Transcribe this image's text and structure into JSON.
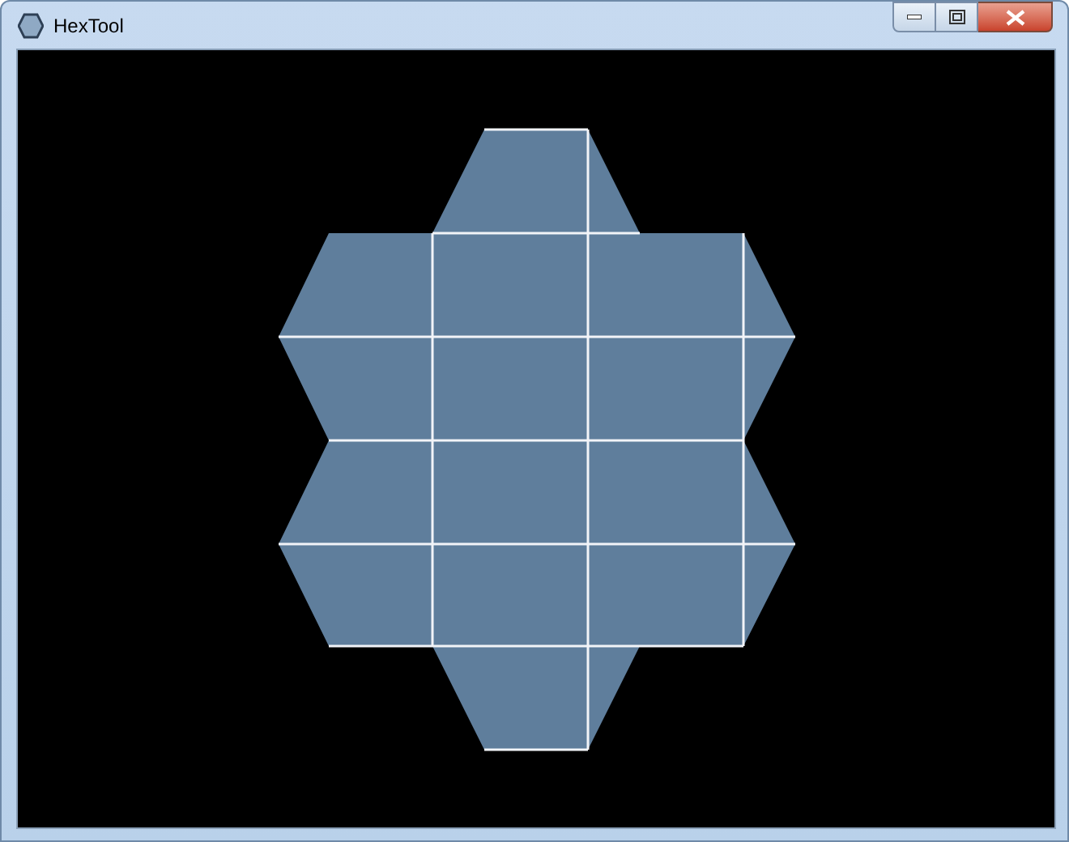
{
  "window": {
    "title": "HexTool"
  }
}
